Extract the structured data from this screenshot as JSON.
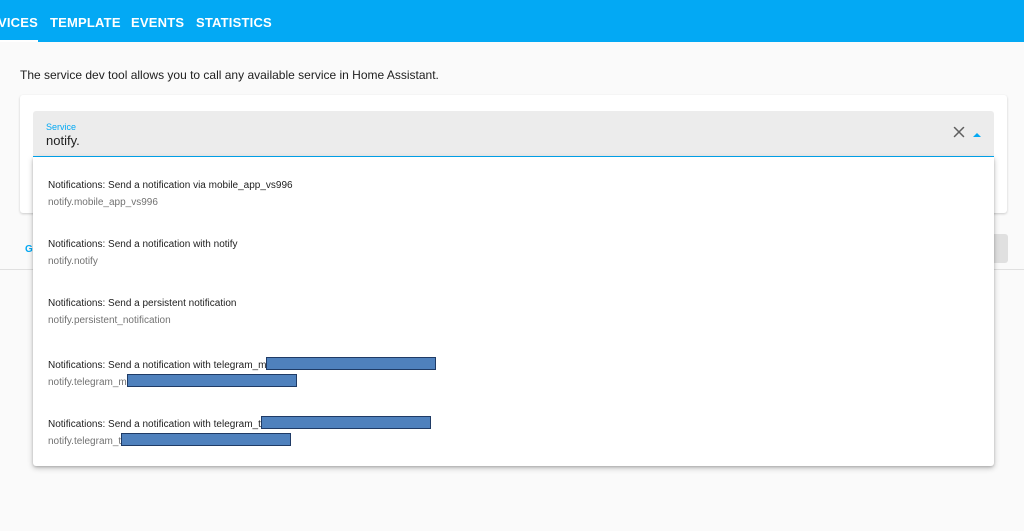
{
  "tabs": [
    {
      "label": "VICES",
      "active": true
    },
    {
      "label": "TEMPLATE",
      "active": false
    },
    {
      "label": "EVENTS",
      "active": false
    },
    {
      "label": "STATISTICS",
      "active": false
    }
  ],
  "description": "The service dev tool allows you to call any available service in Home Assistant.",
  "service_field": {
    "label": "Service",
    "value": "notify."
  },
  "peek_text": "G",
  "icons": {
    "clear": "close-icon",
    "caret": "caret-up-icon"
  },
  "colors": {
    "accent": "#03a9f4",
    "redaction": "#4f81bd"
  },
  "options": [
    {
      "title": "Notifications: Send a notification via mobile_app_vs996",
      "id": "notify.mobile_app_vs996",
      "redacted": false
    },
    {
      "title": "Notifications: Send a notification with notify",
      "id": "notify.notify",
      "redacted": false
    },
    {
      "title": "Notifications: Send a persistent notification",
      "id": "notify.persistent_notification",
      "redacted": false
    },
    {
      "title": "Notifications: Send a notification with telegram_m",
      "id": "notify.telegram_m",
      "redacted": true
    },
    {
      "title": "Notifications: Send a notification with telegram_t",
      "id": "notify.telegram_t",
      "redacted": true
    }
  ]
}
